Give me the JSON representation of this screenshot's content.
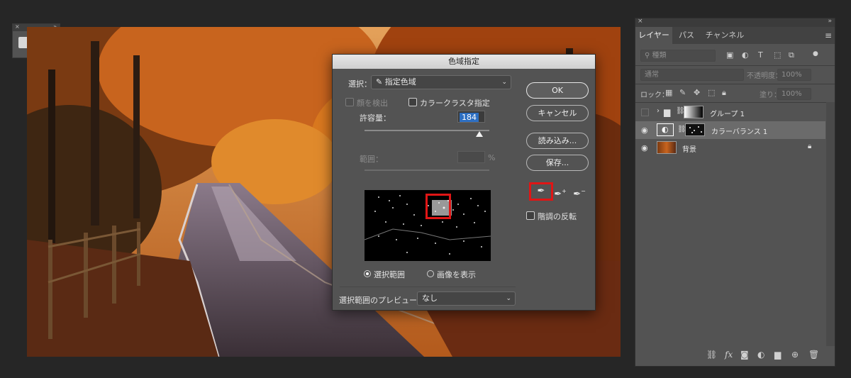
{
  "mini_panel": {
    "close_glyph": "×",
    "collapse_glyph": "»",
    "tool_icon": "3d-tool-icon"
  },
  "dialog": {
    "title": "色域指定",
    "select_label": "選択：",
    "select_value": "指定色域",
    "detect_faces_label": "顔を検出",
    "localized_clusters_label": "カラークラスタ指定",
    "fuzziness_label": "許容量：",
    "fuzziness_value": "184",
    "fuzziness_fraction": 0.92,
    "range_label": "範囲：",
    "range_unit": "%",
    "ok_button": "OK",
    "cancel_button": "キャンセル",
    "load_button": "読み込み...",
    "save_button": "保存...",
    "invert_label": "階調の反転",
    "selection_radio": "選択範囲",
    "image_radio": "画像を表示",
    "preview_label": "選択範囲のプレビュー：",
    "preview_value": "なし",
    "highlight_color": "#e01515"
  },
  "layers_panel": {
    "close_glyph": "×",
    "collapse_glyph": "»",
    "tabs": [
      "レイヤー",
      "パス",
      "チャンネル"
    ],
    "active_tab": "レイヤー",
    "kind_placeholder": "種類",
    "blend_mode": "通常",
    "opacity_label": "不透明度：",
    "opacity_value": "100%",
    "lock_label": "ロック：",
    "fill_label": "塗り：",
    "fill_value": "100%",
    "layers": [
      {
        "name": "グループ 1",
        "type": "group",
        "visible": false
      },
      {
        "name": "カラーバランス 1",
        "type": "adjustment",
        "visible": true,
        "selected": true
      },
      {
        "name": "背景",
        "type": "image",
        "visible": true,
        "locked": true
      }
    ]
  },
  "accent_colors": {
    "selection_blue": "#2d6fc2",
    "annotation_red": "#e01515"
  }
}
